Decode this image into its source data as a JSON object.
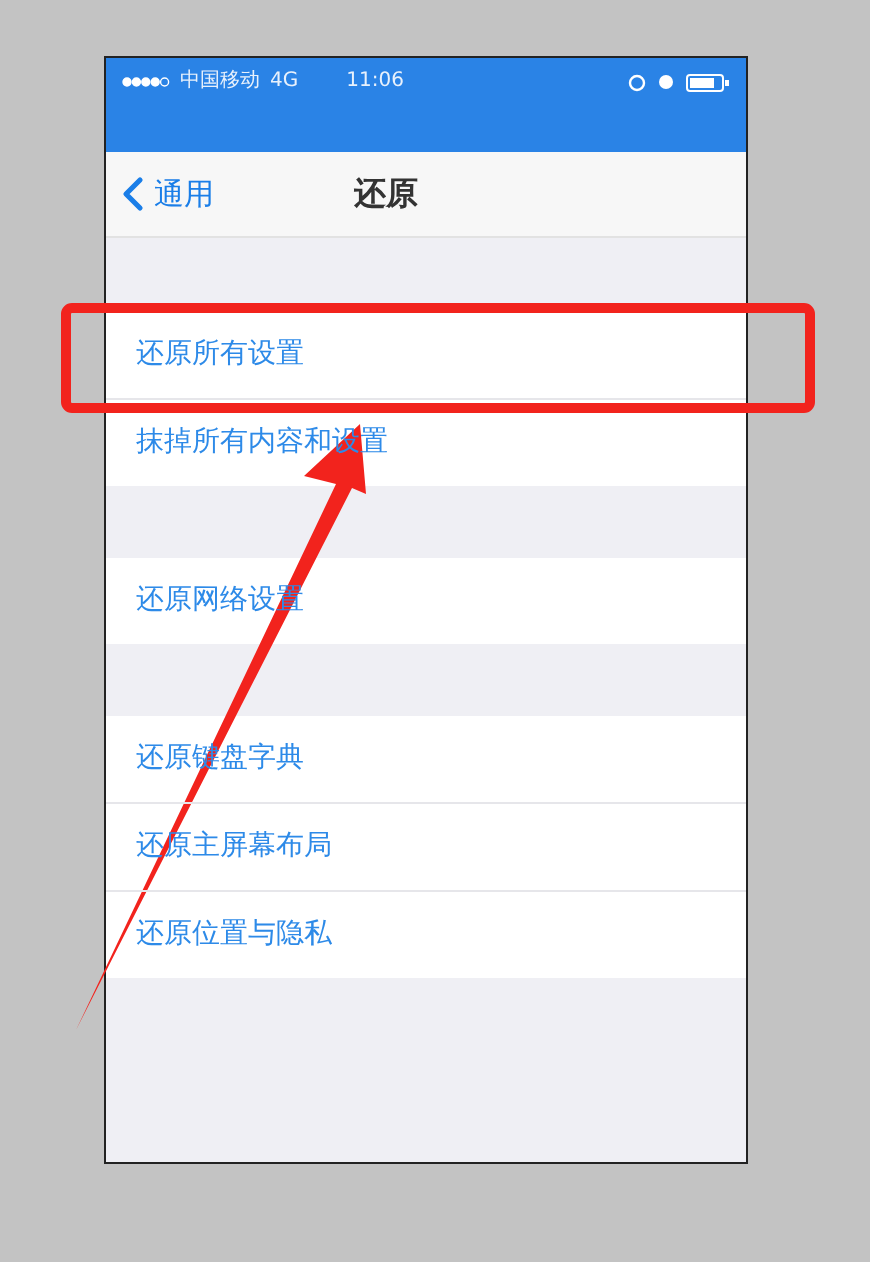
{
  "status_bar": {
    "carrier": "中国移动",
    "network": "4G",
    "time": "11:06"
  },
  "nav_bar": {
    "back": "通用",
    "title": "还原"
  },
  "groups": [
    [
      {
        "label": "还原所有设置",
        "annotated": true
      },
      {
        "label": "抹掉所有内容和设置",
        "annotated": false
      }
    ],
    [
      {
        "label": "还原网络设置",
        "annotated": false
      }
    ],
    [
      {
        "label": "还原键盘字典",
        "annotated": false
      },
      {
        "label": "还原主屏幕布局",
        "annotated": false
      },
      {
        "label": "还原位置与隐私",
        "annotated": false
      }
    ]
  ]
}
